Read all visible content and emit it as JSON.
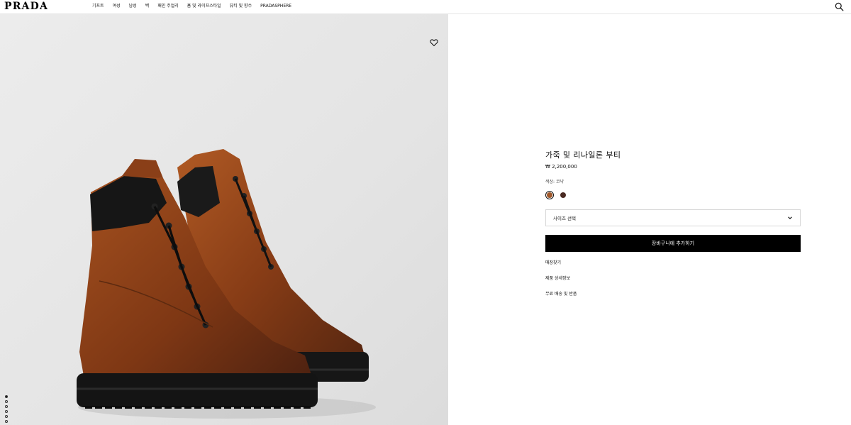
{
  "header": {
    "logo": "PRADA",
    "nav": [
      "기프트",
      "여성",
      "남성",
      "백",
      "패인 주얼리",
      "홈 및 라이프스타일",
      "뷰티 및 향수",
      "PRADASPHERE"
    ]
  },
  "product": {
    "title": "가죽 및 리나일론 부티",
    "price": "₩ 2,200,000",
    "color_label": "색상: 코냑",
    "swatches": [
      {
        "name": "cognac",
        "color": "#a0582a",
        "selected": true
      },
      {
        "name": "dark-brown",
        "color": "#4a2a22",
        "selected": false
      }
    ],
    "size_select_label": "사이즈 선택",
    "add_to_cart": "장바구니에 추가하기",
    "links": [
      "매장찾기",
      "제품 상세정보",
      "무료 배송 및 반품"
    ]
  },
  "gallery": {
    "image_count": 7,
    "active_index": 0
  },
  "colors": {
    "accent": "#000000",
    "leather": "#8a3f18",
    "collar": "#1a1a1a"
  }
}
